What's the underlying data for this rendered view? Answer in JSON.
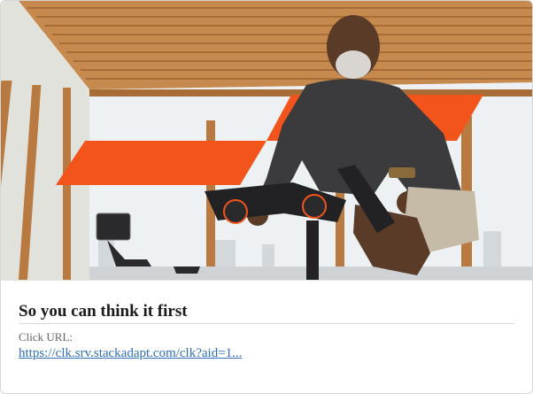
{
  "ad": {
    "image_description_icon": "ad-photo",
    "headline": "So you can think it first",
    "click_url_label": "Click URL:",
    "click_url": "https://clk.srv.stackadapt.com/clk?aid=1..."
  },
  "colors": {
    "brand_orange": "#f2541b",
    "link": "#2e6fb8",
    "headline": "#1a1a1a"
  }
}
